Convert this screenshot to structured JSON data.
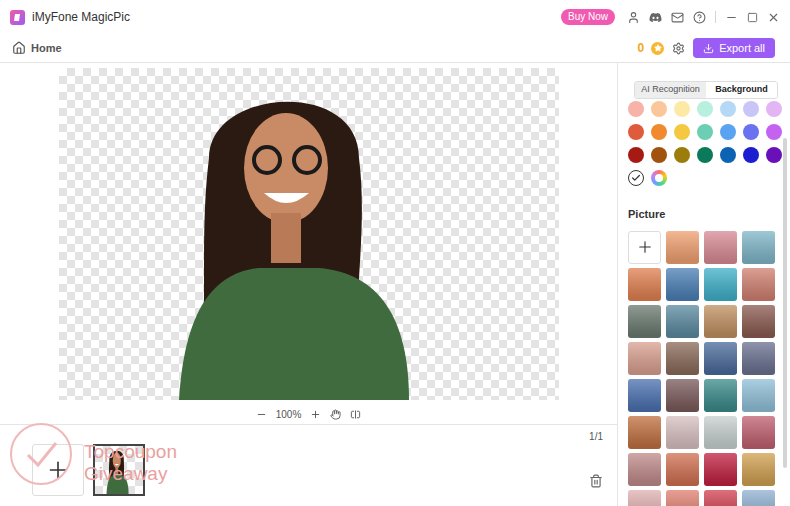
{
  "window": {
    "title": "iMyFone MagicPic"
  },
  "title_bar": {
    "buy_button": "Buy Now"
  },
  "toolbar": {
    "home": "Home",
    "coins": "0",
    "export_button": "Export all"
  },
  "canvas": {
    "zoom": "100%"
  },
  "thumbnails": {
    "page": "1/1",
    "items": [
      {
        "selected": true
      }
    ]
  },
  "watermark": {
    "lines": [
      "Topcoupon",
      "Giveaway"
    ]
  },
  "panel": {
    "tabs": [
      {
        "label": "AI Recognition",
        "selected": false
      },
      {
        "label": "Background",
        "selected": true
      }
    ],
    "swatches": [
      {
        "kind": "color",
        "color": "#f7b3a8",
        "selected": false
      },
      {
        "kind": "color",
        "color": "#f9c79a",
        "selected": false
      },
      {
        "kind": "color",
        "color": "#fde9a6",
        "selected": false
      },
      {
        "kind": "color",
        "color": "#b8f0e0",
        "selected": false
      },
      {
        "kind": "color",
        "color": "#b5d8f7",
        "selected": false
      },
      {
        "kind": "color",
        "color": "#c9c5f7",
        "selected": false
      },
      {
        "kind": "color",
        "color": "#e3b5f5",
        "selected": false
      },
      {
        "kind": "color",
        "color": "#e05a3c",
        "selected": false
      },
      {
        "kind": "color",
        "color": "#ef8a2f",
        "selected": false
      },
      {
        "kind": "color",
        "color": "#f5c842",
        "selected": false
      },
      {
        "kind": "color",
        "color": "#6ccfb4",
        "selected": false
      },
      {
        "kind": "color",
        "color": "#5aa3f0",
        "selected": false
      },
      {
        "kind": "color",
        "color": "#6b72f0",
        "selected": false
      },
      {
        "kind": "color",
        "color": "#c463f0",
        "selected": false
      },
      {
        "kind": "color",
        "color": "#a51b14",
        "selected": false
      },
      {
        "kind": "color",
        "color": "#a1520f",
        "selected": false
      },
      {
        "kind": "color",
        "color": "#9c7d0b",
        "selected": false
      },
      {
        "kind": "color",
        "color": "#0b7a5a",
        "selected": false
      },
      {
        "kind": "color",
        "color": "#0d63b3",
        "selected": false
      },
      {
        "kind": "color",
        "color": "#1b1fd0",
        "selected": false
      },
      {
        "kind": "color",
        "color": "#6a10b8",
        "selected": false
      },
      {
        "kind": "none",
        "selected": true
      },
      {
        "kind": "picker",
        "selected": false
      }
    ],
    "picture_label": "Picture",
    "pictures": [
      {
        "kind": "add"
      },
      {
        "kind": "photo",
        "color": "#f0a070"
      },
      {
        "kind": "photo",
        "color": "#d98a94"
      },
      {
        "kind": "photo",
        "color": "#7fb6c8"
      },
      {
        "kind": "photo",
        "color": "#e08050"
      },
      {
        "kind": "photo",
        "color": "#4a7fb5"
      },
      {
        "kind": "photo",
        "color": "#3fb0c8"
      },
      {
        "kind": "photo",
        "color": "#d08070"
      },
      {
        "kind": "photo",
        "color": "#6a7a70"
      },
      {
        "kind": "photo",
        "color": "#5a8aa0"
      },
      {
        "kind": "photo",
        "color": "#c09060"
      },
      {
        "kind": "photo",
        "color": "#8a5a50"
      },
      {
        "kind": "photo",
        "color": "#d9a090"
      },
      {
        "kind": "photo",
        "color": "#8a6a5a"
      },
      {
        "kind": "photo",
        "color": "#4a6a9a"
      },
      {
        "kind": "photo",
        "color": "#6a7090"
      },
      {
        "kind": "photo",
        "color": "#4a70b0"
      },
      {
        "kind": "photo",
        "color": "#7a5a5a"
      },
      {
        "kind": "photo",
        "color": "#3a8a8a"
      },
      {
        "kind": "photo",
        "color": "#90c0d8"
      },
      {
        "kind": "photo",
        "color": "#c07040"
      },
      {
        "kind": "photo",
        "color": "#d8c0c0"
      },
      {
        "kind": "photo",
        "color": "#c8d0d0"
      },
      {
        "kind": "photo",
        "color": "#c06070"
      },
      {
        "kind": "photo",
        "color": "#c08a8a"
      },
      {
        "kind": "photo",
        "color": "#d07050"
      },
      {
        "kind": "photo",
        "color": "#c02040"
      },
      {
        "kind": "photo",
        "color": "#d0a050"
      },
      {
        "kind": "photo",
        "color": "#e0b0b0"
      },
      {
        "kind": "photo",
        "color": "#e08070"
      },
      {
        "kind": "photo",
        "color": "#d04050"
      },
      {
        "kind": "photo",
        "color": "#90b0d0"
      }
    ]
  }
}
